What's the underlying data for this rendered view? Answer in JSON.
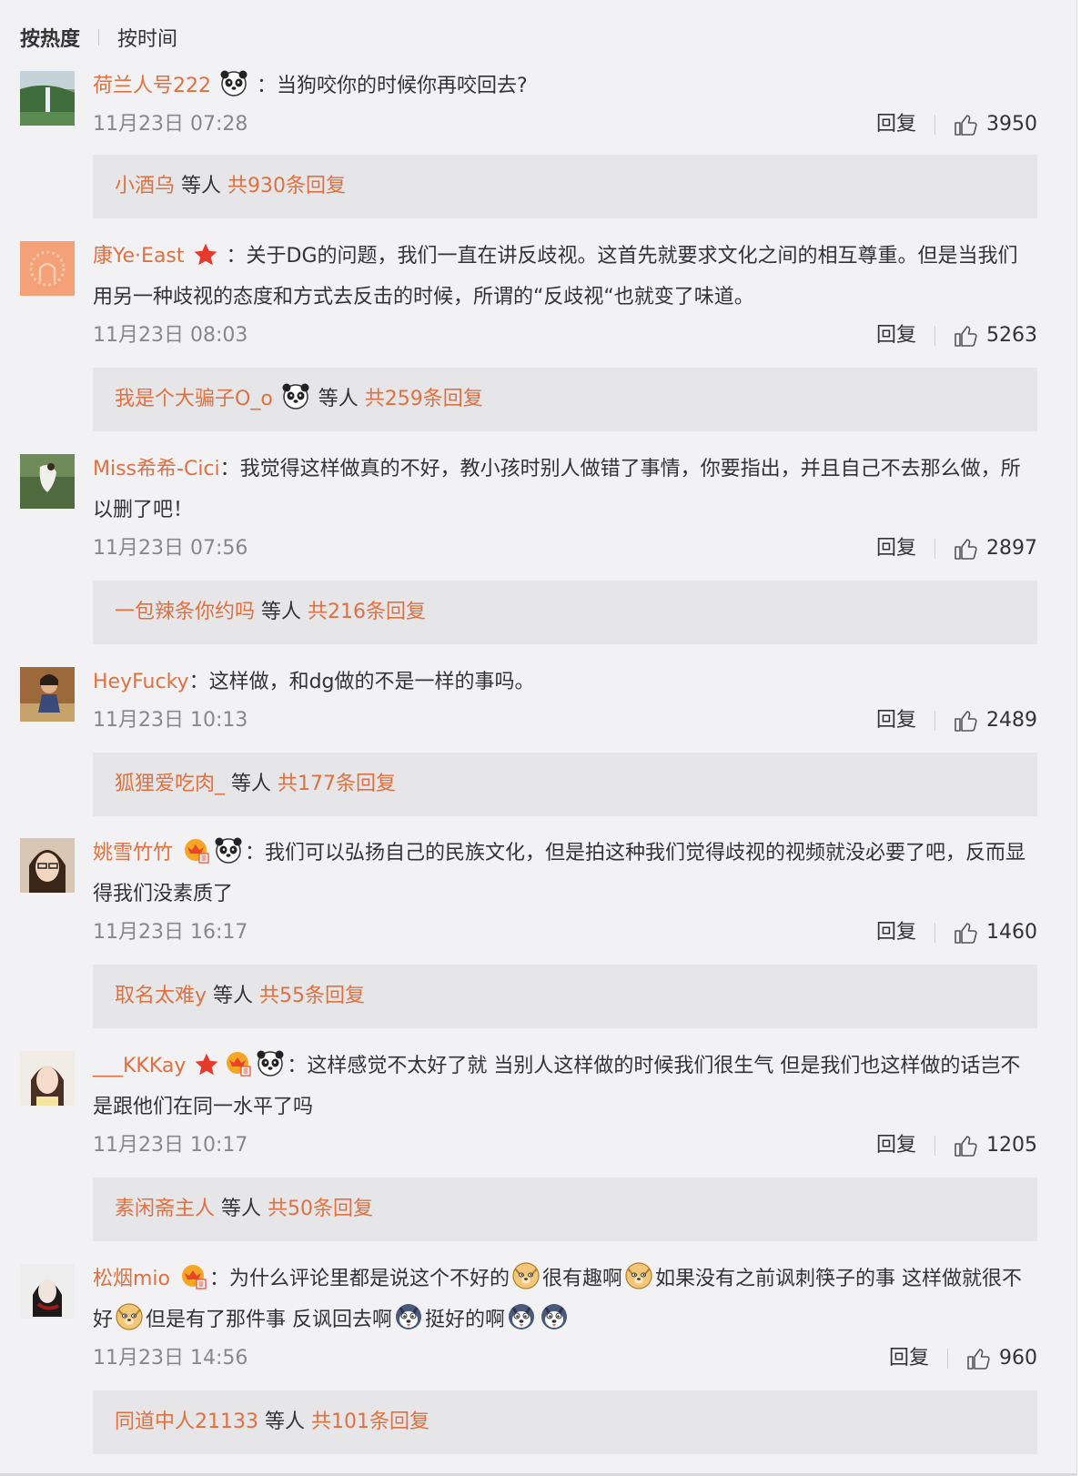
{
  "sort": {
    "hot": "按热度",
    "time": "按时间"
  },
  "reply_label": "回复",
  "others_label": "等人",
  "comments": [
    {
      "name": "荷兰人号222",
      "text": "：当狗咬你的时候你再咬回去?",
      "time": "11月23日 07:28",
      "likes": "3950",
      "reply_user": "小酒乌",
      "reply_total": "共930条回复"
    },
    {
      "name": "康Ye·East",
      "text": "：关于DG的问题，我们一直在讲反歧视。这首先就要求文化之间的相互尊重。但是当我们用另一种歧视的态度和方式去反击的时候，所谓的“反歧视“也就变了味道。",
      "time": "11月23日 08:03",
      "likes": "5263",
      "reply_user": "我是个大骗子O_o",
      "reply_total": "共259条回复"
    },
    {
      "name": "Miss希希-Cici",
      "text": "：我觉得这样做真的不好，教小孩时别人做错了事情，你要指出，并且自己不去那么做，所以删了吧！",
      "time": "11月23日 07:56",
      "likes": "2897",
      "reply_user": "一包辣条你约吗",
      "reply_total": "共216条回复"
    },
    {
      "name": "HeyFucky",
      "text": "：这样做，和dg做的不是一样的事吗。",
      "time": "11月23日 10:13",
      "likes": "2489",
      "reply_user": "狐狸爱吃肉_",
      "reply_total": "共177条回复"
    },
    {
      "name": "姚雪竹竹",
      "text": "：我们可以弘扬自己的民族文化，但是拍这种我们觉得歧视的视频就没必要了吧，反而显得我们没素质了",
      "time": "11月23日 16:17",
      "likes": "1460",
      "reply_user": "取名太难y",
      "reply_total": "共55条回复"
    },
    {
      "name": "___KKKay",
      "text": "：这样感觉不太好了就 当别人这样做的时候我们很生气 但是我们也这样做的话岂不是跟他们在同一水平了吗",
      "time": "11月23日 10:17",
      "likes": "1205",
      "reply_user": "素闲斋主人",
      "reply_total": "共50条回复"
    },
    {
      "name": "松烟mio",
      "text_parts": [
        "：为什么评论里都是说这个不好的",
        "很有趣啊",
        "如果没有之前讽刺筷子的事 这样做就很不好",
        "但是有了那件事 反讽回去啊",
        "挺好的啊"
      ],
      "time": "11月23日 14:56",
      "likes": "960",
      "reply_user": "同道中人21133",
      "reply_total": "共101条回复"
    }
  ]
}
